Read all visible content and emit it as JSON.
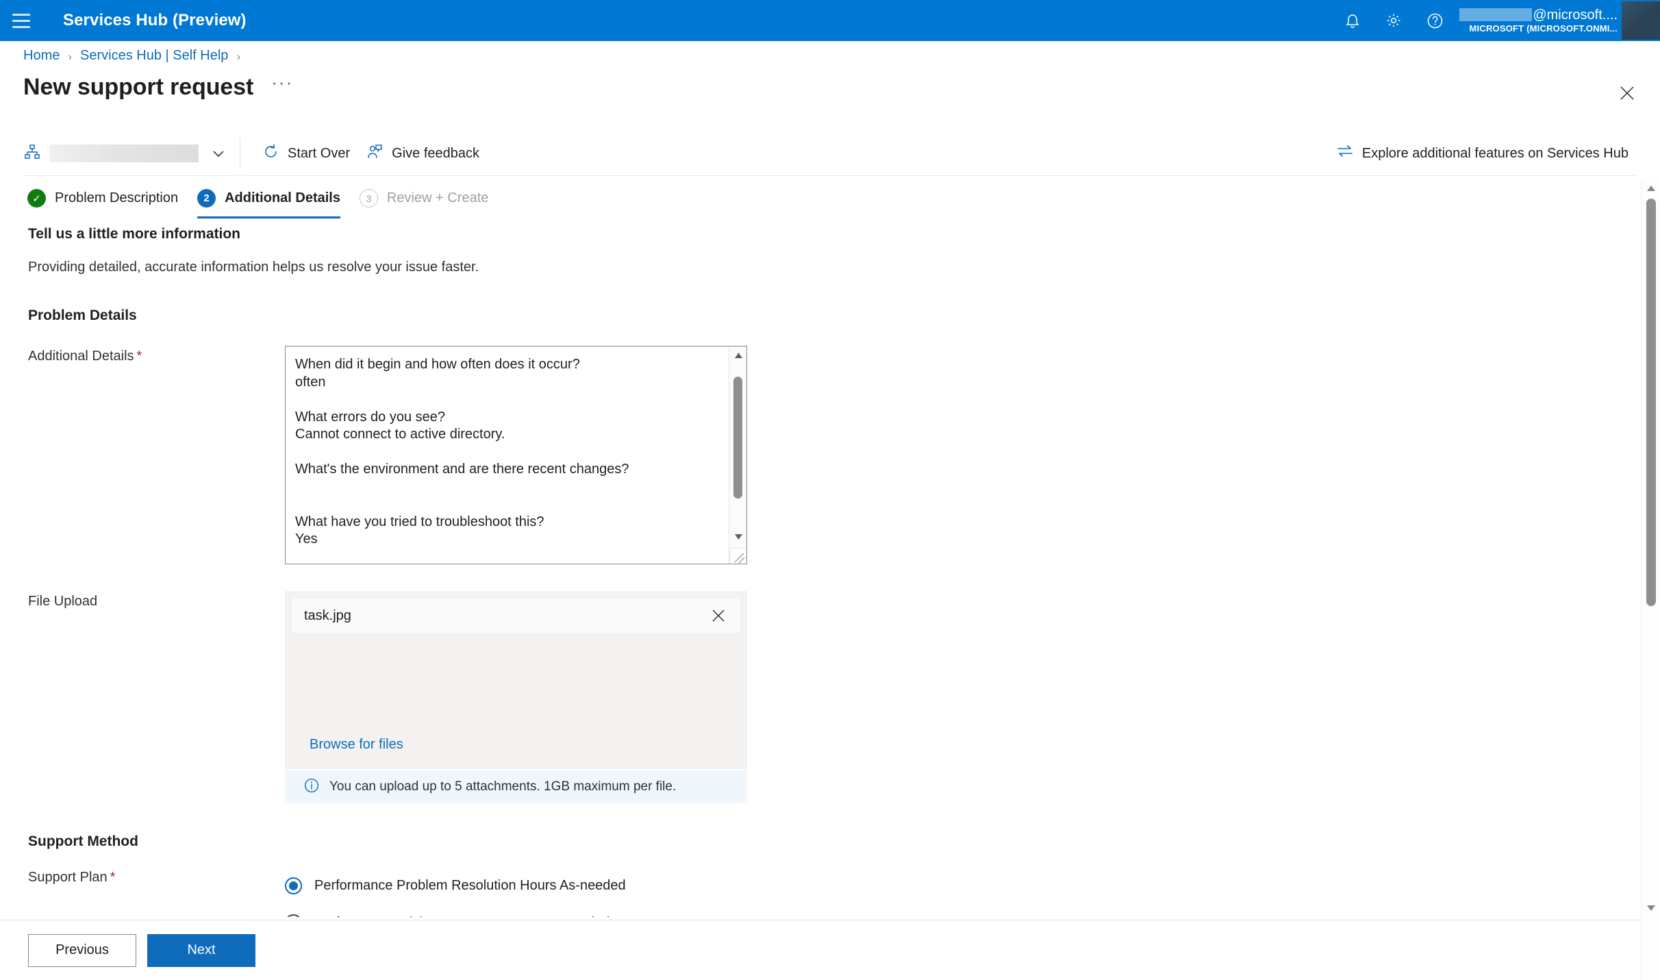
{
  "topbar": {
    "menu_icon": "hamburger-icon",
    "app_title": "Services Hub (Preview)",
    "notification_icon": "bell-icon",
    "settings_icon": "gear-icon",
    "help_icon": "question-circle-icon",
    "account": {
      "email_suffix": "@microsoft....",
      "tenant": "MICROSOFT (MICROSOFT.ONMI...",
      "email_redacted": true
    },
    "brand_color": "#0078d4"
  },
  "breadcrumb": {
    "items": [
      {
        "label": "Home"
      },
      {
        "label": "Services Hub | Self Help"
      }
    ],
    "separator": "›",
    "trailing_separator": "›"
  },
  "page": {
    "title": "New support request",
    "more_label": "···",
    "close_icon": "close-icon"
  },
  "command_bar": {
    "scope_icon": "org-hierarchy-icon",
    "scope_value_redacted": true,
    "scope_chevron_icon": "chevron-down-icon",
    "start_over": {
      "label": "Start Over",
      "icon": "refresh-icon"
    },
    "give_feedback": {
      "label": "Give feedback",
      "icon": "person-feedback-icon"
    },
    "explore": {
      "label": "Explore additional features on Services Hub",
      "icon": "swap-arrows-icon"
    }
  },
  "wizard": {
    "steps": [
      {
        "number": "✓",
        "label": "Problem Description",
        "state": "done"
      },
      {
        "number": "2",
        "label": "Additional Details",
        "state": "active"
      },
      {
        "number": "3",
        "label": "Review + Create",
        "state": "todo"
      }
    ],
    "active_color": "#0f6cbd",
    "done_color": "#107c10"
  },
  "main": {
    "heading": "Tell us a little more information",
    "subheading": "Providing detailed, accurate information helps us resolve your issue faster.",
    "problem_details": {
      "group_title": "Problem Details",
      "additional_details": {
        "label": "Additional Details",
        "required": true,
        "required_marker": "*",
        "value": "When did it begin and how often does it occur?\noften\n\nWhat errors do you see?\nCannot connect to active directory.\n\nWhat's the environment and are there recent changes?\n\n\nWhat have you tried to troubleshoot this?\nYes",
        "scrollbar": {
          "up_icon": "caret-up-icon",
          "down_icon": "caret-down-icon"
        },
        "resize_handle_icon": "resize-handle-icon"
      },
      "file_upload": {
        "label": "File Upload",
        "files": [
          {
            "name": "task.jpg",
            "remove_icon": "close-icon"
          }
        ],
        "browse_label": "Browse for files",
        "note": "You can upload up to 5 attachments. 1GB maximum per file.",
        "note_icon": "info-circle-icon"
      }
    },
    "support_method": {
      "group_title": "Support Method",
      "support_plan": {
        "label": "Support Plan",
        "required": true,
        "required_marker": "*",
        "options": [
          {
            "label": "Performance Problem Resolution Hours As-needed",
            "selected": true
          },
          {
            "label": "Performance Advisory Support Hours As-needed",
            "selected": false
          }
        ]
      }
    }
  },
  "footer": {
    "previous_label": "Previous",
    "next_label": "Next"
  },
  "scrollbar": {
    "up_icon": "caret-up-icon",
    "down_icon": "caret-down-icon"
  }
}
